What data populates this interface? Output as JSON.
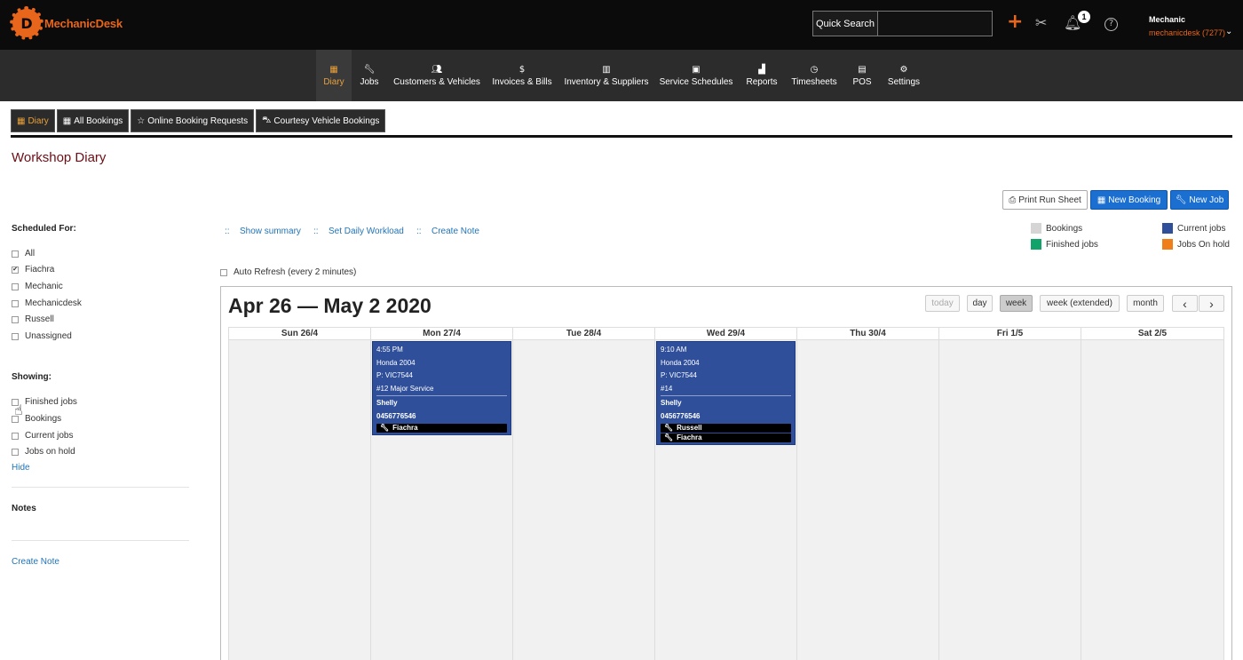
{
  "app": {
    "logo_text": "MechanicDesk",
    "logo_letter": "D"
  },
  "topbar": {
    "quick_search_label": "Quick Search",
    "quick_search_value": "",
    "notification_count": "1",
    "user_role": "Mechanic",
    "user_account": "mechanicdesk (7277)"
  },
  "nav": [
    {
      "label": "Diary",
      "icon": "calendar-icon"
    },
    {
      "label": "Jobs",
      "icon": "wrench-icon"
    },
    {
      "label": "Customers & Vehicles",
      "icon": "users-icon"
    },
    {
      "label": "Invoices & Bills",
      "icon": "dollar-icon"
    },
    {
      "label": "Inventory & Suppliers",
      "icon": "warehouse-icon"
    },
    {
      "label": "Service Schedules",
      "icon": "clipboard-icon"
    },
    {
      "label": "Reports",
      "icon": "chart-icon"
    },
    {
      "label": "Timesheets",
      "icon": "clock-icon"
    },
    {
      "label": "POS",
      "icon": "store-icon"
    },
    {
      "label": "Settings",
      "icon": "gear-icon"
    }
  ],
  "subtabs": [
    "Diary",
    "All Bookings",
    "Online Booking Requests",
    "Courtesy Vehicle Bookings"
  ],
  "page_title": "Workshop Diary",
  "actions": {
    "print": "Print Run Sheet",
    "new_booking": "New Booking",
    "new_job": "New Job"
  },
  "legend": [
    {
      "label": "Bookings",
      "color": "#d5d5d5"
    },
    {
      "label": "Current jobs",
      "color": "#2f4f9a"
    },
    {
      "label": "Finished jobs",
      "color": "#12a36b"
    },
    {
      "label": "Jobs On hold",
      "color": "#f07f1a"
    }
  ],
  "toolbar": {
    "sep": "::",
    "show_summary": "Show summary",
    "set_workload": "Set Daily Workload",
    "create_note": "Create Note"
  },
  "auto_refresh": "Auto Refresh (every 2 minutes)",
  "sidebar": {
    "scheduled_for_heading": "Scheduled For:",
    "scheduled_for": [
      {
        "label": "All",
        "checked": false
      },
      {
        "label": "Fiachra",
        "checked": true
      },
      {
        "label": "Mechanic",
        "checked": false
      },
      {
        "label": "Mechanicdesk",
        "checked": false
      },
      {
        "label": "Russell",
        "checked": false
      },
      {
        "label": "Unassigned",
        "checked": false
      }
    ],
    "showing_heading": "Showing:",
    "showing": [
      {
        "label": "Finished jobs",
        "checked": false
      },
      {
        "label": "Bookings",
        "checked": false
      },
      {
        "label": "Current jobs",
        "checked": false
      },
      {
        "label": "Jobs on hold",
        "checked": false
      }
    ],
    "hide_link": "Hide",
    "notes_heading": "Notes",
    "create_note_link": "Create Note"
  },
  "calendar": {
    "title": "Apr 26 — May 2 2020",
    "view_buttons": {
      "today": "today",
      "day": "day",
      "week": "week",
      "week_ext": "week (extended)",
      "month": "month",
      "prev": "‹",
      "next": "›"
    },
    "active_view": "week",
    "days": [
      "Sun 26/4",
      "Mon 27/4",
      "Tue 28/4",
      "Wed 29/4",
      "Thu 30/4",
      "Fri 1/5",
      "Sat 2/5"
    ],
    "events": [
      {
        "day": "Mon 27/4",
        "time": "4:55 PM",
        "vehicle": "Honda 2004",
        "plate": "P: VIC7544",
        "job": "#12 Major Service",
        "customer": "Shelly",
        "phone": "0456776546",
        "mechanics": [
          "Fiachra"
        ]
      },
      {
        "day": "Wed 29/4",
        "time": "9:10 AM",
        "vehicle": "Honda 2004",
        "plate": "P: VIC7544",
        "job": "#14",
        "customer": "Shelly",
        "phone": "0456776546",
        "mechanics": [
          "Russell",
          "Fiachra"
        ]
      }
    ]
  }
}
